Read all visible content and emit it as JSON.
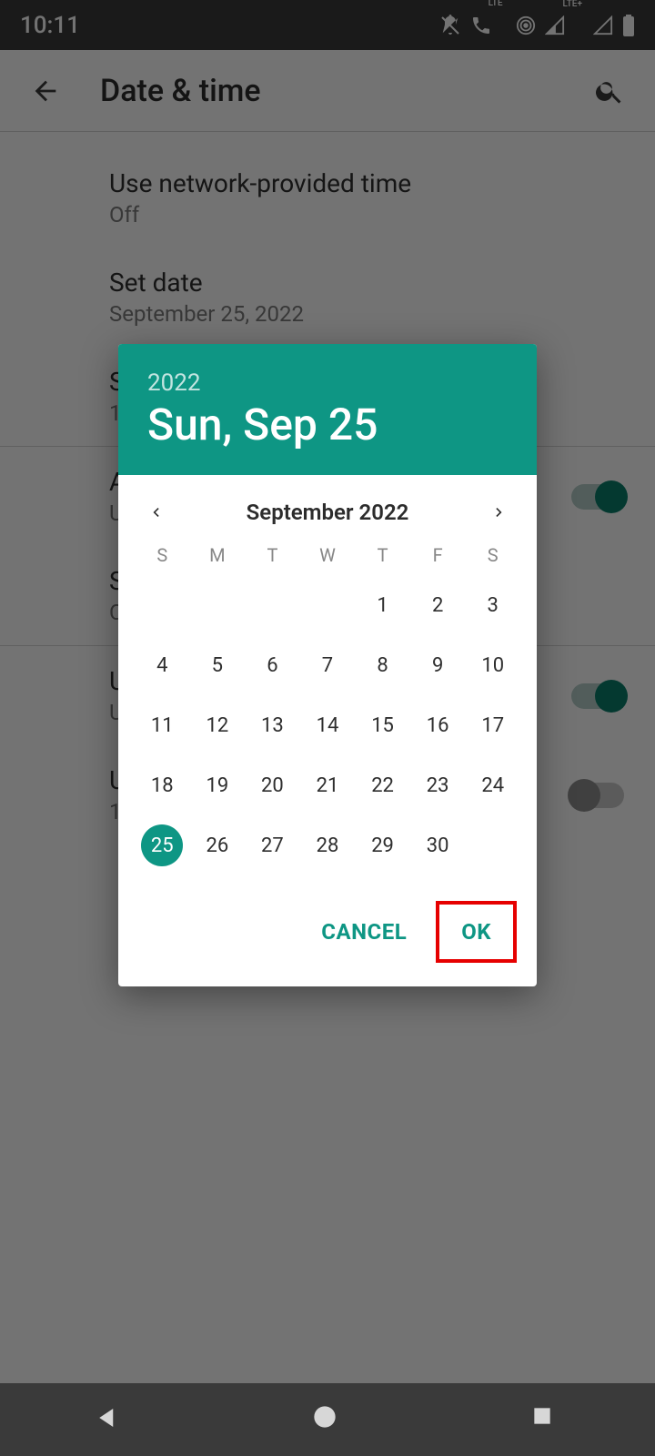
{
  "status": {
    "time": "10:11"
  },
  "appbar": {
    "title": "Date & time"
  },
  "settings": {
    "networkTime": {
      "title": "Use network-provided time",
      "value": "Off"
    },
    "setDate": {
      "title": "Set date",
      "value": "September 25, 2022"
    },
    "setTime": {
      "title": "S",
      "value": "1"
    },
    "autoTz": {
      "title": "A",
      "value": "U"
    },
    "locTz": {
      "title": "S",
      "value": "C"
    },
    "useLocale": {
      "title": "U",
      "value": "U"
    },
    "use24h": {
      "title": "U",
      "value": "1"
    }
  },
  "picker": {
    "year": "2022",
    "dateLabel": "Sun, Sep 25",
    "monthLabel": "September 2022",
    "dow": [
      "S",
      "M",
      "T",
      "W",
      "T",
      "F",
      "S"
    ],
    "firstDayOffset": 4,
    "daysInMonth": 30,
    "selectedDay": 25,
    "cancel": "CANCEL",
    "ok": "OK"
  }
}
